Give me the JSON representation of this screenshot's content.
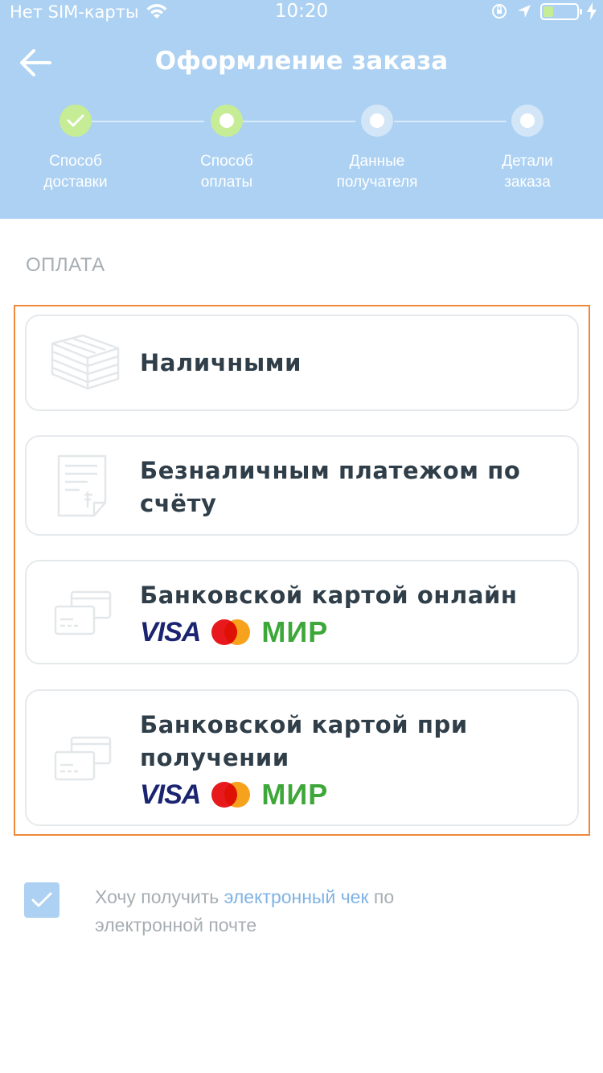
{
  "status_bar": {
    "carrier": "Нет SIM-карты",
    "time": "10:20"
  },
  "header": {
    "title": "Оформление заказа",
    "back_icon": "arrow-left-icon",
    "background": "#acd1f2"
  },
  "steps": [
    {
      "line1": "Способ",
      "line2": "доставки",
      "state": "done"
    },
    {
      "line1": "Способ",
      "line2": "оплаты",
      "state": "current"
    },
    {
      "line1": "Данные",
      "line2": "получателя",
      "state": "pending"
    },
    {
      "line1": "Детали",
      "line2": "заказа",
      "state": "pending"
    }
  ],
  "payment": {
    "section_title": "ОПЛАТА",
    "options": [
      {
        "line1": "Наличными",
        "icon": "cash-stack-icon"
      },
      {
        "line1": "Безналичным платежом по",
        "line2": "счёту",
        "icon": "invoice-icon"
      },
      {
        "line1": "Банковской картой онлайн",
        "icon": "cards-icon",
        "brands": [
          "VISA",
          "МИР"
        ]
      },
      {
        "line1": "Банковской картой при",
        "line2": "получении",
        "icon": "cards-icon",
        "brands": [
          "VISA",
          "МИР"
        ]
      }
    ]
  },
  "receipt": {
    "checked": true,
    "text_before": "Хочу получить ",
    "link_text": "электронный чек",
    "text_after": " по",
    "line2": "электронной почте"
  },
  "colors": {
    "accent": "#acd1f2",
    "step_done": "#c6ec96",
    "highlight_border": "#f0883a",
    "link": "#7fb3e4"
  }
}
